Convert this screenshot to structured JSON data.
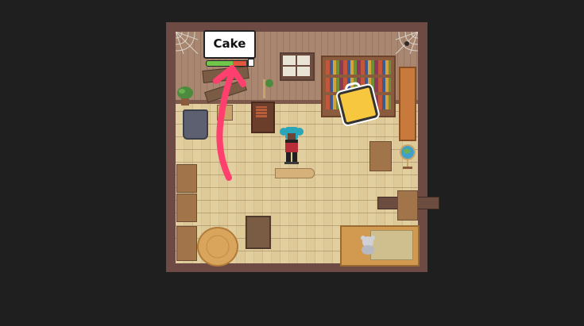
{
  "scene": {
    "name": "room",
    "colors": {
      "background": "#1f1f1f",
      "wall": "#a98670",
      "floor": "#e2cf9f",
      "arrow": "#ff3f6e",
      "item_highlight": "#f7c83f"
    }
  },
  "task": {
    "label": "Cake",
    "progress_green": 0.62,
    "progress_red": 0.3
  },
  "icons": {
    "pickup": "bag-icon",
    "arrow": "curved-arrow-icon",
    "player": "player-character-icon"
  }
}
